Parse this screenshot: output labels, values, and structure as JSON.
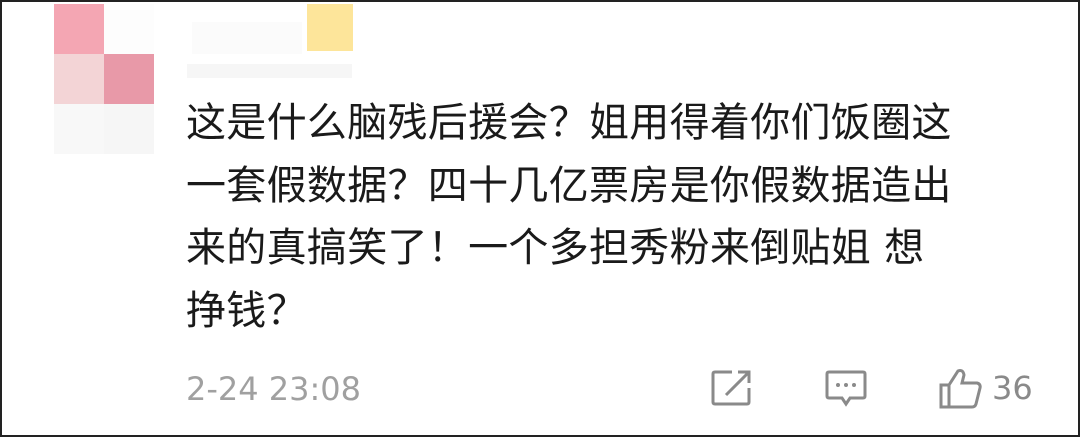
{
  "user": {
    "avatar_colors": [
      "#f4a6b3",
      "#ffffff",
      "#f3d4d6",
      "#e899a8",
      "#f5f5f5",
      "#f7f7f7"
    ],
    "badge_color": "#fde59a"
  },
  "comment": {
    "lines": [
      "这是什么脑残后援会？姐用得着你们饭圈这",
      "一套假数据？四十几亿票房是你假数据造出",
      "来的真搞笑了！一个多担秀粉来倒贴姐 想",
      "挣钱？"
    ],
    "timestamp": "2-24 23:08"
  },
  "actions": {
    "share_icon": "share-icon",
    "reply_icon": "comment-icon",
    "like_icon": "thumbs-up-icon",
    "like_count": "36"
  },
  "icon_color": "#8a8a8a"
}
